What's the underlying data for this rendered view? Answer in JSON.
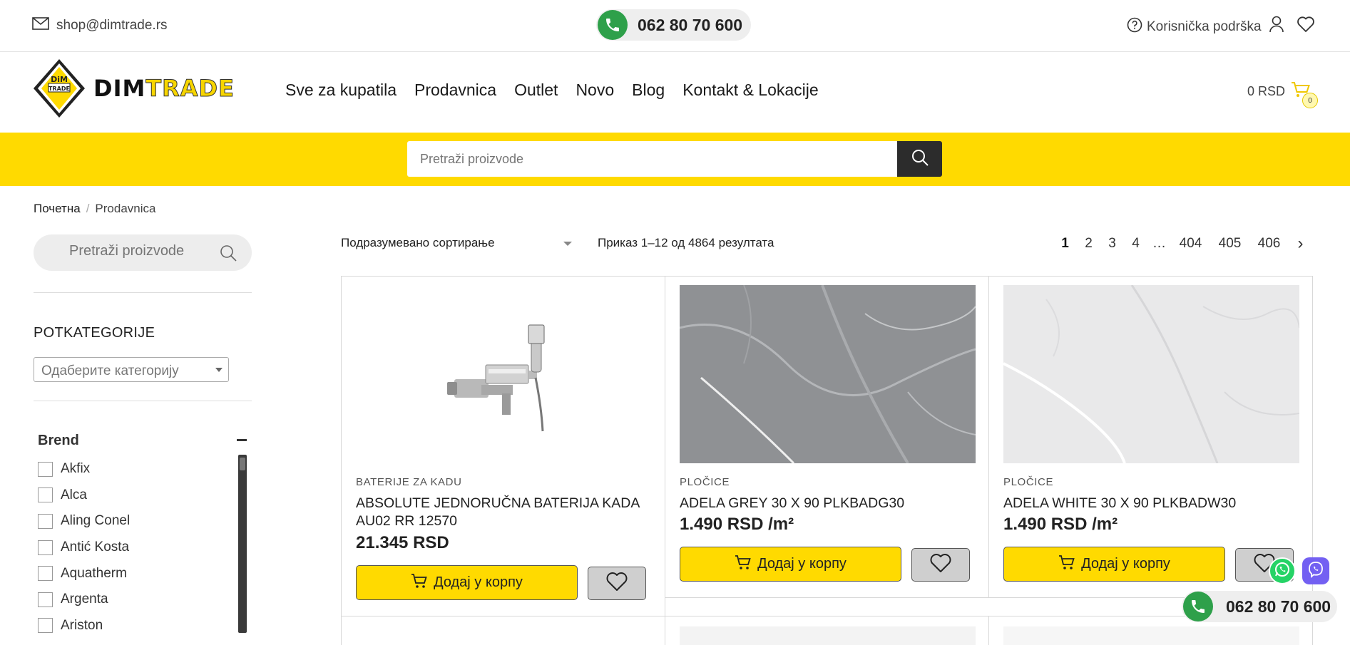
{
  "topbar": {
    "email": "shop@dimtrade.rs",
    "phone": "062 80 70 600",
    "support_label": "Korisnička podrška"
  },
  "header": {
    "logo_text_dim": "DIM",
    "logo_text_trade": "TRADE",
    "logo_badge_text": "DIM TRADE",
    "nav": [
      "Sve za kupatila",
      "Prodavnica",
      "Outlet",
      "Novo",
      "Blog",
      "Kontakt & Lokacije"
    ],
    "cart_total": "0 RSD",
    "cart_count": "0"
  },
  "search": {
    "placeholder": "Pretraži proizvode"
  },
  "breadcrumb": {
    "home": "Почетна",
    "separator": "/",
    "current": "Prodavnica"
  },
  "sidebar": {
    "search_placeholder": "Pretraži proizvode",
    "subcategories_title": "POTKATEGORIJE",
    "category_select": "Одаберите категорију",
    "brand_title": "Brend",
    "brands": [
      "Akfix",
      "Alca",
      "Aling Conel",
      "Antić Kosta",
      "Aquatherm",
      "Argenta",
      "Ariston"
    ]
  },
  "toolbar": {
    "sort_selected": "Подразумевано сортирање",
    "result_count": "Приказ 1–12 од 4864 резултата",
    "pages": [
      "1",
      "2",
      "3",
      "4",
      "…",
      "404",
      "405",
      "406"
    ],
    "next": "›",
    "current_page": "1"
  },
  "products": [
    {
      "category": "BATERIJE ZA KADU",
      "title": "ABSOLUTE JEDNORUČNA BATERIJA KADA AU02 RR 12570",
      "price": "21.345 RSD",
      "add_label": "Додај у корпу"
    },
    {
      "category": "PLOČICE",
      "title": "ADELA GREY 30 X 90 PLKBADG30",
      "price": "1.490 RSD /m²",
      "add_label": "Додај у корпу"
    },
    {
      "category": "PLOČICE",
      "title": "ADELA WHITE 30 X 90 PLKBADW30",
      "price": "1.490 RSD /m²",
      "add_label": "Додај у корпу"
    }
  ],
  "floating": {
    "phone": "062 80 70 600"
  },
  "colors": {
    "brand_yellow": "#ffda00",
    "dark": "#2c2c2c",
    "phone_green": "#2ea04a"
  }
}
